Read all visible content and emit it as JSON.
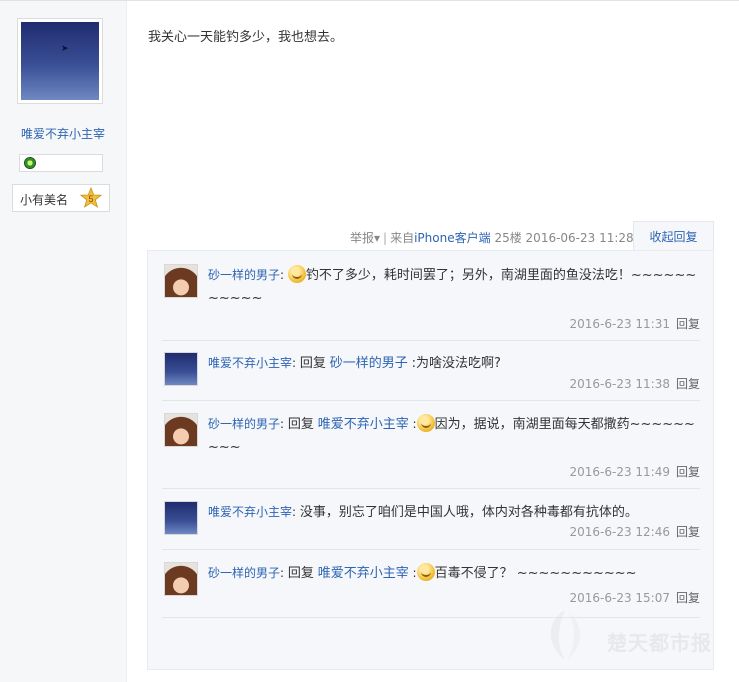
{
  "post": {
    "text": "我关心一天能钓多少，我也想去。",
    "meta": {
      "report": "举报▾",
      "from_prefix": "来自",
      "from_client": "iPhone客户端",
      "floor": "25楼",
      "time": "2016-06-23 11:28",
      "separator": "|"
    },
    "collapse_label": "收起回复"
  },
  "author": {
    "name": "唯爱不弃小主宰",
    "level_title": "小有美名",
    "level_number": "5"
  },
  "replies": [
    {
      "user": "砂一样的男子",
      "avatar": "girl-avatar",
      "has_emoji": true,
      "content": "钓不了多少，耗时间罢了；另外，南湖里面的鱼没法吃！~~~~~~~~~~~",
      "time": "2016-6-23 11:31",
      "reply_label": "回复"
    },
    {
      "user": "唯爱不弃小主宰",
      "avatar": "sky-avatar",
      "reply_word": "回复",
      "target": "砂一样的男子",
      "content": ":为啥没法吃啊?",
      "time": "2016-6-23 11:38",
      "reply_label": "回复"
    },
    {
      "user": "砂一样的男子",
      "avatar": "girl-avatar",
      "reply_word": "回复",
      "target": "唯爱不弃小主宰",
      "has_emoji": true,
      "content": "因为，据说，南湖里面每天都撒药~~~~~~~~~",
      "time": "2016-6-23 11:49",
      "reply_label": "回复"
    },
    {
      "user": "唯爱不弃小主宰",
      "avatar": "sky-avatar",
      "content": "没事，别忘了咱们是中国人哦，体内对各种毒都有抗体的。",
      "time": "2016-6-23 12:46",
      "reply_label": "回复"
    },
    {
      "user": "砂一样的男子",
      "avatar": "girl-avatar",
      "reply_word": "回复",
      "target": "唯爱不弃小主宰",
      "has_emoji": true,
      "content": "百毒不侵了？ ~~~~~~~~~~~",
      "time": "2016-6-23 15:07",
      "reply_label": "回复"
    }
  ],
  "watermark": {
    "text": "楚天都市报"
  }
}
